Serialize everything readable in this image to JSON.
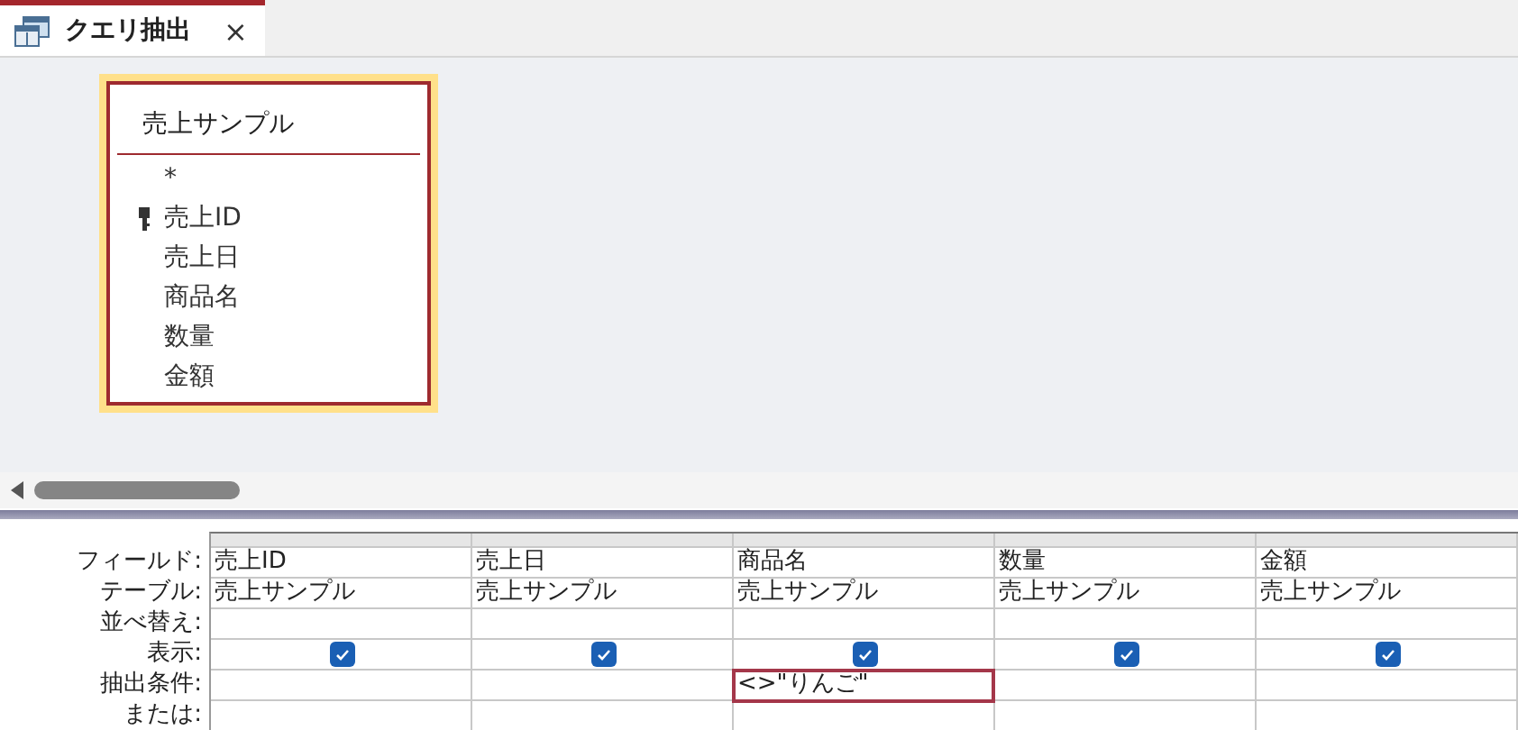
{
  "tabs": [
    {
      "label": "クエリ抽出",
      "selected": true,
      "close": "×"
    }
  ],
  "table_box": {
    "title": "売上サンプル",
    "fields": [
      {
        "name": "*",
        "primary_key": false
      },
      {
        "name": "売上ID",
        "primary_key": true
      },
      {
        "name": "売上日",
        "primary_key": false
      },
      {
        "name": "商品名",
        "primary_key": false
      },
      {
        "name": "数量",
        "primary_key": false
      },
      {
        "name": "金額",
        "primary_key": false
      }
    ]
  },
  "grid": {
    "row_labels": [
      "フィールド:",
      "テーブル:",
      "並べ替え:",
      "表示:",
      "抽出条件:",
      "または:"
    ],
    "columns": [
      {
        "field": "売上ID",
        "table": "売上サンプル",
        "show": true,
        "criteria_selected": false
      },
      {
        "field": "売上日",
        "table": "売上サンプル",
        "show": true,
        "criteria_selected": false
      },
      {
        "field": "商品名",
        "table": "売上サンプル",
        "show": true,
        "criteria": "<>\"りんご\"",
        "criteria_selected": true
      },
      {
        "field": "数量",
        "table": "売上サンプル",
        "show": true,
        "criteria_selected": false
      },
      {
        "field": "金額",
        "table": "売上サンプル",
        "show": true,
        "criteria_selected": false
      }
    ]
  }
}
